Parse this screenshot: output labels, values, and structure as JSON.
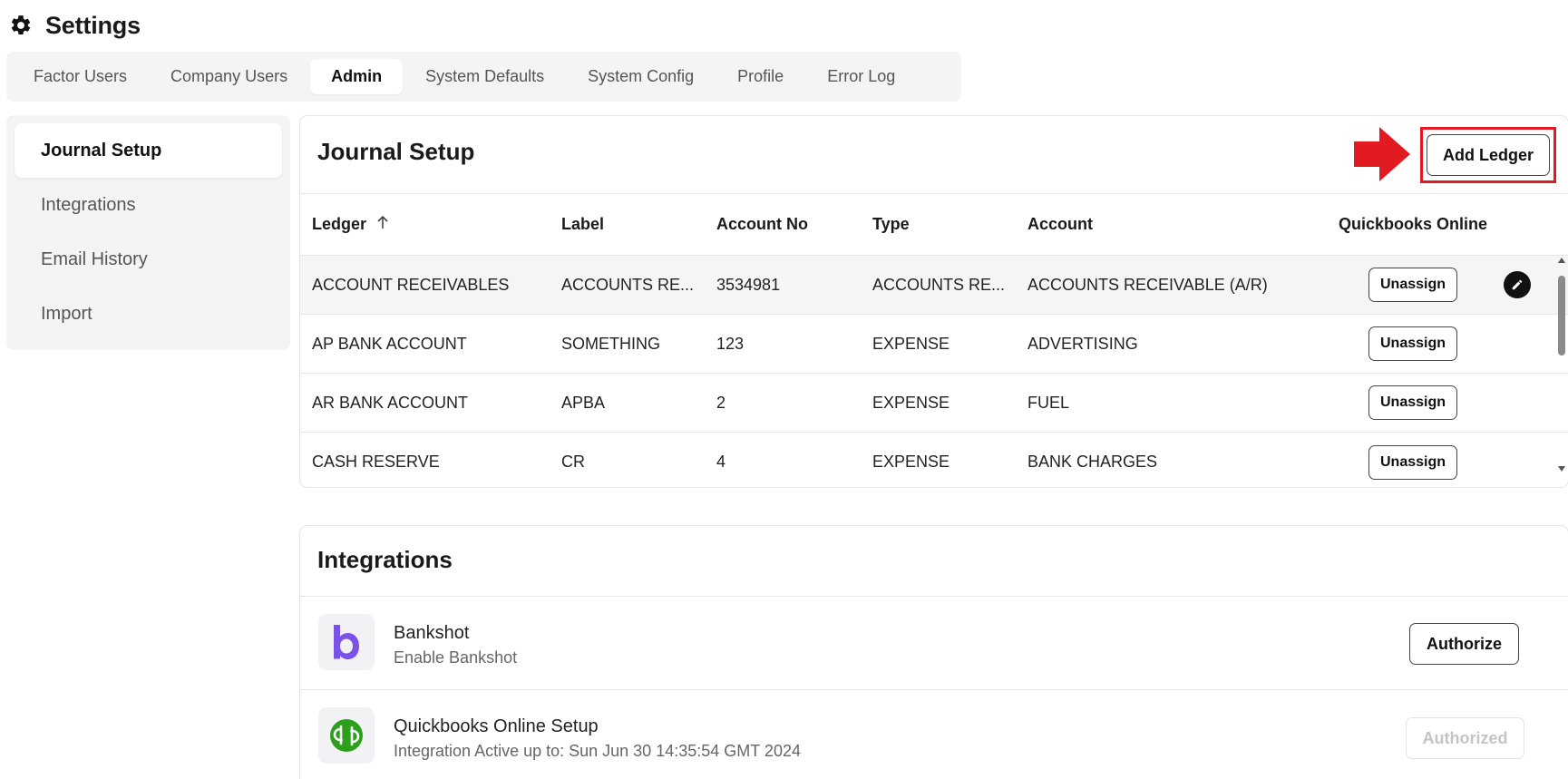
{
  "page": {
    "title": "Settings",
    "icon": "gear-icon"
  },
  "tabs": [
    {
      "label": "Factor Users",
      "active": false
    },
    {
      "label": "Company Users",
      "active": false
    },
    {
      "label": "Admin",
      "active": true
    },
    {
      "label": "System Defaults",
      "active": false
    },
    {
      "label": "System Config",
      "active": false
    },
    {
      "label": "Profile",
      "active": false
    },
    {
      "label": "Error Log",
      "active": false
    }
  ],
  "sidebar": {
    "items": [
      {
        "label": "Journal Setup",
        "active": true
      },
      {
        "label": "Integrations",
        "active": false
      },
      {
        "label": "Email History",
        "active": false
      },
      {
        "label": "Import",
        "active": false
      }
    ]
  },
  "journal": {
    "title": "Journal Setup",
    "add_button": "Add Ledger",
    "highlight_color": "#e21b22",
    "columns": [
      "Ledger",
      "Label",
      "Account No",
      "Type",
      "Account",
      "Quickbooks Online"
    ],
    "sort_icon": "arrow-up-icon",
    "rows": [
      {
        "ledger": "ACCOUNT RECEIVABLES",
        "label": "ACCOUNTS RE...",
        "account_no": "3534981",
        "type": "ACCOUNTS RE...",
        "account": "ACCOUNTS RECEIVABLE (A/R)",
        "action": "Unassign"
      },
      {
        "ledger": "AP BANK ACCOUNT",
        "label": "SOMETHING",
        "account_no": "123",
        "type": "EXPENSE",
        "account": "ADVERTISING",
        "action": "Unassign"
      },
      {
        "ledger": "AR BANK ACCOUNT",
        "label": "APBA",
        "account_no": "2",
        "type": "EXPENSE",
        "account": "FUEL",
        "action": "Unassign"
      },
      {
        "ledger": "CASH RESERVE",
        "label": "CR",
        "account_no": "4",
        "type": "EXPENSE",
        "account": "BANK CHARGES",
        "action": "Unassign"
      }
    ]
  },
  "integrations": {
    "title": "Integrations",
    "items": [
      {
        "name": "Bankshot",
        "description": "Enable Bankshot",
        "action": "Authorize",
        "logo": "bankshot-logo",
        "color": "#7b52e8"
      },
      {
        "name": "Quickbooks Online Setup",
        "description": "Integration Active up to: Sun Jun 30 14:35:54 GMT 2024",
        "action": "Authorized",
        "logo": "quickbooks-logo",
        "color": "#2ca01c"
      }
    ]
  }
}
